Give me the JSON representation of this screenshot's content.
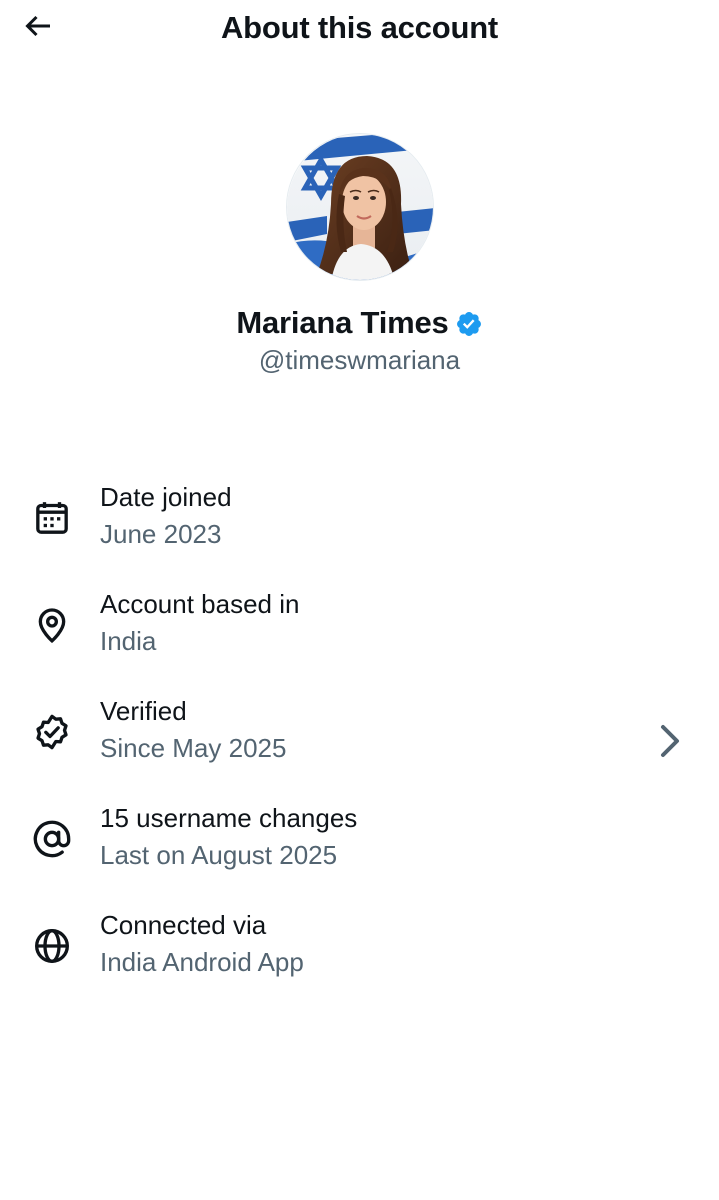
{
  "header": {
    "back_icon": "arrow-left-icon",
    "title": "About this account"
  },
  "profile": {
    "avatar_icon": "profile-photo",
    "display_name": "Mariana Times",
    "verified_icon": "verified-badge-icon",
    "handle": "@timeswmariana"
  },
  "info": {
    "items": [
      {
        "icon": "calendar-icon",
        "label": "Date joined",
        "value": "June 2023"
      },
      {
        "icon": "location-pin-icon",
        "label": "Account based in",
        "value": "India"
      },
      {
        "icon": "verified-outline-icon",
        "label": "Verified",
        "value": "Since May 2025",
        "has_chevron": true
      },
      {
        "icon": "at-sign-icon",
        "label": "15 username changes",
        "value": "Last on August 2025"
      },
      {
        "icon": "globe-icon",
        "label": "Connected via",
        "value": "India Android App"
      }
    ]
  },
  "colors": {
    "text_primary": "#0f1419",
    "text_secondary": "#536471",
    "verified_blue": "#1d9bf0",
    "background": "#ffffff"
  }
}
